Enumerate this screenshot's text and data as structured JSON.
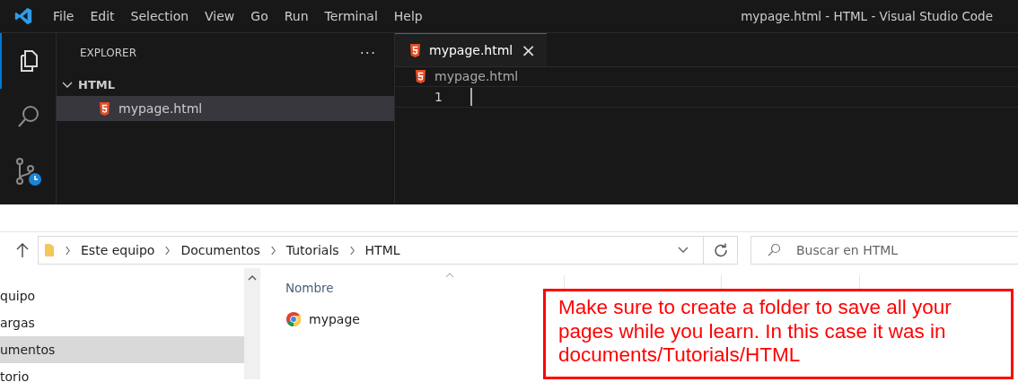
{
  "vscode": {
    "menu": [
      "File",
      "Edit",
      "Selection",
      "View",
      "Go",
      "Run",
      "Terminal",
      "Help"
    ],
    "window_title": "mypage.html - HTML - Visual Studio Code",
    "activity_bar": [
      {
        "kind": "explorer",
        "selected": true
      },
      {
        "kind": "search",
        "selected": false
      },
      {
        "kind": "source-control",
        "selected": false
      }
    ],
    "explorer": {
      "title": "EXPLORER",
      "more": "···",
      "folder": {
        "name": "HTML",
        "expanded": true,
        "children": [
          {
            "name": "mypage.html",
            "selected": true
          }
        ]
      }
    },
    "tabs": [
      {
        "label": "mypage.html",
        "close": "×",
        "selected": true
      }
    ],
    "breadcrumb": "mypage.html",
    "line_numbers": [
      "1"
    ]
  },
  "file_explorer": {
    "path": [
      "Este equipo",
      "Documentos",
      "Tutorials",
      "HTML"
    ],
    "search": {
      "placeholder": "Buscar en HTML"
    },
    "nav_items": [
      {
        "label": "quipo",
        "selected": false
      },
      {
        "label": "argas",
        "selected": false
      },
      {
        "label": "umentos",
        "selected": true
      },
      {
        "label": "torio",
        "selected": false
      }
    ],
    "columns": [
      "Nombre"
    ],
    "files": [
      {
        "name": "mypage"
      }
    ]
  },
  "callout": "Make sure to create a folder to save all your pages while you learn. In this case it was in documents/Tutorials/HTML"
}
